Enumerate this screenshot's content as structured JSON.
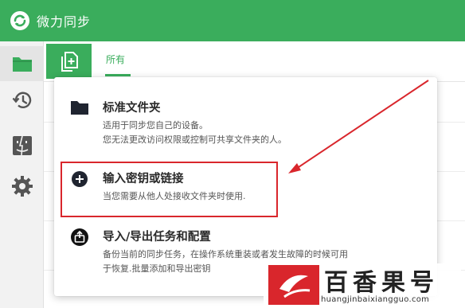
{
  "app": {
    "title": "微力同步"
  },
  "sidebar": {
    "items": [
      {
        "name": "folders",
        "icon": "folder-icon"
      },
      {
        "name": "history",
        "icon": "history-icon"
      },
      {
        "name": "finder",
        "icon": "finder-icon"
      },
      {
        "name": "settings",
        "icon": "gear-icon"
      }
    ]
  },
  "toolbar": {
    "new_button_icon": "add-folder-icon",
    "tabs": [
      {
        "label": "所有",
        "active": true
      }
    ]
  },
  "menu": {
    "items": [
      {
        "icon": "folder-icon",
        "label": "标准文件夹",
        "desc_lines": [
          "适用于同步您自己的设备。",
          "您无法更改访问权限或控制可共享文件夹的人。"
        ]
      },
      {
        "icon": "plus-circle-icon",
        "label": "输入密钥或链接",
        "desc_lines": [
          "当您需要从他人处接收文件夹时使用."
        ]
      },
      {
        "icon": "export-icon",
        "label": "导入/导出任务和配置",
        "desc_lines": [
          "备份当前的同步任务，在操作系统重装或者发生故障的时候可用",
          "于恢复.批量添加和导出密钥"
        ]
      }
    ]
  },
  "annotation": {
    "color": "#d9262c"
  },
  "watermark": {
    "cn": "百香果号",
    "en": "huangjinbaixiangguo.com"
  },
  "colors": {
    "brand_green": "#3aad5c",
    "highlight_red": "#d9262c"
  }
}
